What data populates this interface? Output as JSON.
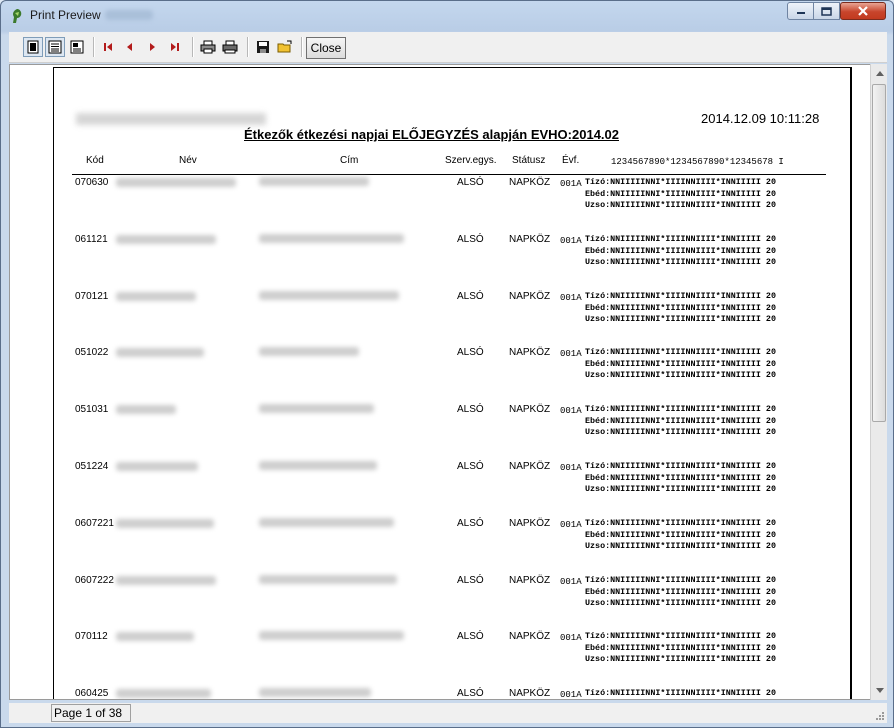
{
  "window": {
    "title": "Print Preview",
    "title_ghost_text": "",
    "colors": {
      "titlebar": "#c4d7ee",
      "close": "#c8452c",
      "page": "#ffffff"
    }
  },
  "toolbar": {
    "buttons": [
      "one-page-view-icon",
      "continuous-view-icon",
      "zoom-view-icon",
      "first-page-icon",
      "previous-page-icon",
      "next-page-icon",
      "last-page-icon",
      "print-setup-icon",
      "print-icon",
      "save-icon",
      "open-icon"
    ],
    "close_label": "Close"
  },
  "report": {
    "datetime": "2014.12.09 10:11:28",
    "title": "Étkezők étkezési napjai ELŐJEGYZÉS alapján  EVHO:2014.02",
    "headers": {
      "kod": "Kód",
      "nev": "Név",
      "cim": "Cím",
      "szerv": "Szerv.egys.",
      "status": "Státusz",
      "evf": "Évf.",
      "days": "1234567890*1234567890*12345678 I"
    },
    "rows": [
      {
        "kod": "070630",
        "szerv": "ALSÓ",
        "status": "NAPKÖZ",
        "evf": "001A",
        "lines": [
          "Tízó:NNIIIIINNI*IIIINNIIII*INNIIIII 20",
          "Ebéd:NNIIIIINNI*IIIINNIIII*INNIIIII 20",
          "Uzso:NNIIIIINNI*IIIINNIIII*INNIIIII 20"
        ]
      },
      {
        "kod": "061121",
        "szerv": "ALSÓ",
        "status": "NAPKÖZ",
        "evf": "001A",
        "lines": [
          "Tízó:NNIIIIINNI*IIIINNIIII*INNIIIII 20",
          "Ebéd:NNIIIIINNI*IIIINNIIII*INNIIIII 20",
          "Uzso:NNIIIIINNI*IIIINNIIII*INNIIIII 20"
        ]
      },
      {
        "kod": "070121",
        "szerv": "ALSÓ",
        "status": "NAPKÖZ",
        "evf": "001A",
        "lines": [
          "Tízó:NNIIIIINNI*IIIINNIIII*INNIIIII 20",
          "Ebéd:NNIIIIINNI*IIIINNIIII*INNIIIII 20",
          "Uzso:NNIIIIINNI*IIIINNIIII*INNIIIII 20"
        ]
      },
      {
        "kod": "051022",
        "szerv": "ALSÓ",
        "status": "NAPKÖZ",
        "evf": "001A",
        "lines": [
          "Tízó:NNIIIIINNI*IIIINNIIII*INNIIIII 20",
          "Ebéd:NNIIIIINNI*IIIINNIIII*INNIIIII 20",
          "Uzso:NNIIIIINNI*IIIINNIIII*INNIIIII 20"
        ]
      },
      {
        "kod": "051031",
        "szerv": "ALSÓ",
        "status": "NAPKÖZ",
        "evf": "001A",
        "lines": [
          "Tízó:NNIIIIINNI*IIIINNIIII*INNIIIII 20",
          "Ebéd:NNIIIIINNI*IIIINNIIII*INNIIIII 20",
          "Uzso:NNIIIIINNI*IIIINNIIII*INNIIIII 20"
        ]
      },
      {
        "kod": "051224",
        "szerv": "ALSÓ",
        "status": "NAPKÖZ",
        "evf": "001A",
        "lines": [
          "Tízó:NNIIIIINNI*IIIINNIIII*INNIIIII 20",
          "Ebéd:NNIIIIINNI*IIIINNIIII*INNIIIII 20",
          "Uzso:NNIIIIINNI*IIIINNIIII*INNIIIII 20"
        ]
      },
      {
        "kod": "0607221",
        "szerv": "ALSÓ",
        "status": "NAPKÖZ",
        "evf": "001A",
        "lines": [
          "Tízó:NNIIIIINNI*IIIINNIIII*INNIIIII 20",
          "Ebéd:NNIIIIINNI*IIIINNIIII*INNIIIII 20",
          "Uzso:NNIIIIINNI*IIIINNIIII*INNIIIII 20"
        ]
      },
      {
        "kod": "0607222",
        "szerv": "ALSÓ",
        "status": "NAPKÖZ",
        "evf": "001A",
        "lines": [
          "Tízó:NNIIIIINNI*IIIINNIIII*INNIIIII 20",
          "Ebéd:NNIIIIINNI*IIIINNIIII*INNIIIII 20",
          "Uzso:NNIIIIINNI*IIIINNIIII*INNIIIII 20"
        ]
      },
      {
        "kod": "070112",
        "szerv": "ALSÓ",
        "status": "NAPKÖZ",
        "evf": "001A",
        "lines": [
          "Tízó:NNIIIIINNI*IIIINNIIII*INNIIIII 20",
          "Ebéd:NNIIIIINNI*IIIINNIIII*INNIIIII 20",
          "Uzso:NNIIIIINNI*IIIINNIIII*INNIIIII 20"
        ]
      },
      {
        "kod": "060425",
        "szerv": "ALSÓ",
        "status": "NAPKÖZ",
        "evf": "001A",
        "lines": [
          "Tízó:NNIIIIINNI*IIIINNIIII*INNIIIII 20"
        ]
      }
    ]
  },
  "status": {
    "page_info": "Page 1 of 38"
  }
}
